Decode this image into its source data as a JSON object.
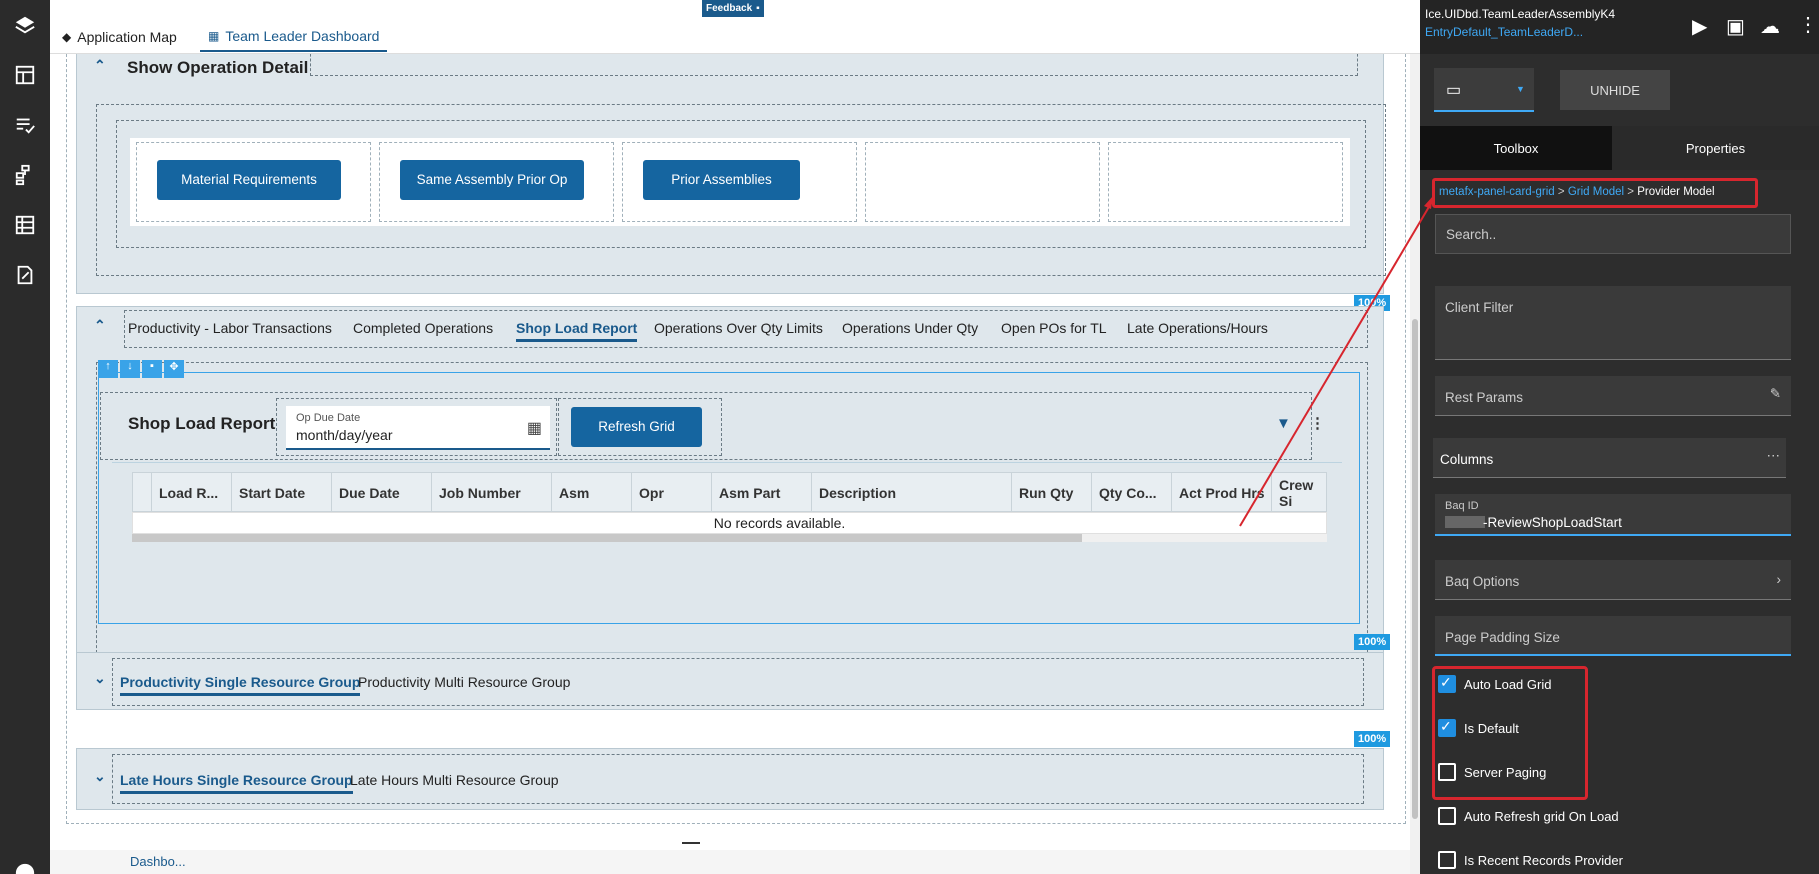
{
  "app": {
    "tabs": [
      {
        "label": "Application Map",
        "icon": "layers-icon"
      },
      {
        "label": "Team Leader Dashboard",
        "icon": "grid-icon"
      }
    ],
    "feedback_label": "Feedback"
  },
  "rail": {
    "icons": [
      "layers-icon",
      "dashboard-icon",
      "checklist-icon",
      "hierarchy-icon",
      "table-icon",
      "edit-doc-icon"
    ]
  },
  "operation_detail": {
    "title": "Show Operation Detail",
    "buttons": [
      "Material Requirements",
      "Same Assembly Prior Op",
      "Prior Assemblies"
    ]
  },
  "tabs_main": {
    "items": [
      "Productivity - Labor Transactions",
      "Completed Operations",
      "Shop Load Report",
      "Operations Over Qty Limits",
      "Operations Under Qty",
      "Open POs for TL",
      "Late Operations/Hours"
    ],
    "active": "Shop Load Report"
  },
  "shop_load": {
    "title": "Shop Load Report",
    "date_label": "Op Due Date",
    "date_value": "month/day/year",
    "refresh_label": "Refresh Grid",
    "columns": [
      "Load R...",
      "Start Date",
      "Due Date",
      "Job Number",
      "Asm",
      "Opr",
      "Asm Part",
      "Description",
      "Run Qty",
      "Qty Co...",
      "Act Prod Hrs",
      "Crew Si"
    ],
    "empty_text": "No records available."
  },
  "percent_badges": [
    "100%",
    "100%",
    "100%"
  ],
  "prod_group": {
    "tabs": [
      "Productivity Single Resource Group",
      "Productivity Multi Resource Group"
    ]
  },
  "late_group": {
    "tabs": [
      "Late Hours Single Resource Group",
      "Late Hours Multi Resource Group"
    ]
  },
  "bottom_text": "Dashbo...",
  "right_panel": {
    "assembly_name": "Ice.UIDbd.TeamLeaderAssemblyK4",
    "entry_name": "EntryDefault_TeamLeaderD...",
    "unhide_label": "UNHIDE",
    "panel_tabs": [
      "Toolbox",
      "Properties"
    ],
    "breadcrumb": [
      "metafx-panel-card-grid",
      "Grid Model",
      "Provider Model"
    ],
    "search_placeholder": "Search..",
    "client_filter_label": "Client Filter",
    "rest_params_label": "Rest Params",
    "columns_label": "Columns",
    "baq_id_label": "Baq ID",
    "baq_id_value": "-ReviewShopLoadStart",
    "baq_options_label": "Baq Options",
    "page_padding_label": "Page Padding Size",
    "checkboxes": [
      {
        "label": "Auto Load Grid",
        "checked": true
      },
      {
        "label": "Is Default",
        "checked": true
      },
      {
        "label": "Server Paging",
        "checked": false
      },
      {
        "label": "Auto Refresh grid On Load",
        "checked": false
      },
      {
        "label": "Is Recent Records Provider",
        "checked": false
      }
    ]
  },
  "colors": {
    "accent": "#1565a0",
    "badge": "#1f9ae0",
    "highlight_red": "#d7262e",
    "panel_bg": "#2d2d2d"
  }
}
